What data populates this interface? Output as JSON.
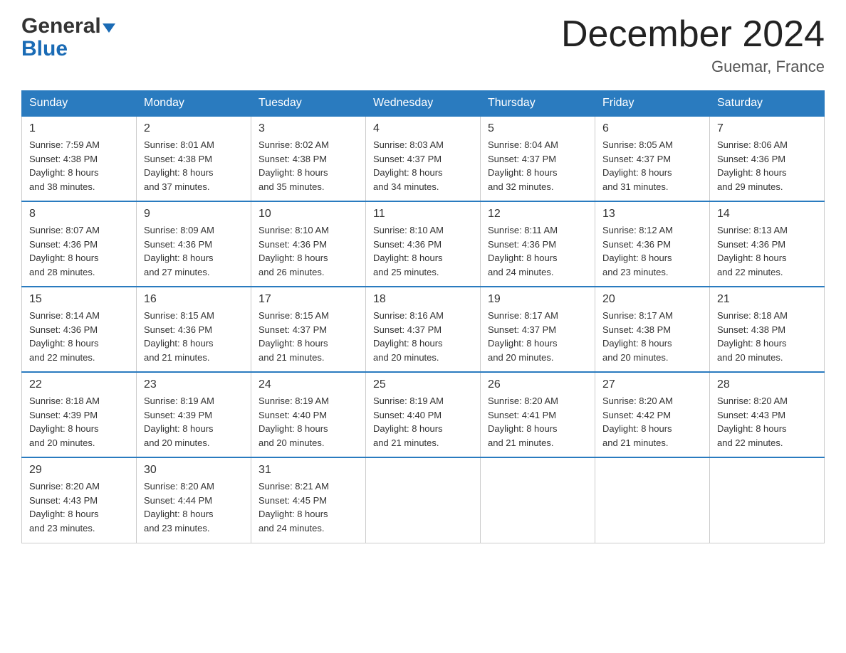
{
  "logo": {
    "general": "General",
    "blue": "Blue",
    "triangle": "▼"
  },
  "title": "December 2024",
  "location": "Guemar, France",
  "days_of_week": [
    "Sunday",
    "Monday",
    "Tuesday",
    "Wednesday",
    "Thursday",
    "Friday",
    "Saturday"
  ],
  "weeks": [
    [
      {
        "day": "1",
        "sunrise": "7:59 AM",
        "sunset": "4:38 PM",
        "daylight": "8 hours and 38 minutes."
      },
      {
        "day": "2",
        "sunrise": "8:01 AM",
        "sunset": "4:38 PM",
        "daylight": "8 hours and 37 minutes."
      },
      {
        "day": "3",
        "sunrise": "8:02 AM",
        "sunset": "4:38 PM",
        "daylight": "8 hours and 35 minutes."
      },
      {
        "day": "4",
        "sunrise": "8:03 AM",
        "sunset": "4:37 PM",
        "daylight": "8 hours and 34 minutes."
      },
      {
        "day": "5",
        "sunrise": "8:04 AM",
        "sunset": "4:37 PM",
        "daylight": "8 hours and 32 minutes."
      },
      {
        "day": "6",
        "sunrise": "8:05 AM",
        "sunset": "4:37 PM",
        "daylight": "8 hours and 31 minutes."
      },
      {
        "day": "7",
        "sunrise": "8:06 AM",
        "sunset": "4:36 PM",
        "daylight": "8 hours and 29 minutes."
      }
    ],
    [
      {
        "day": "8",
        "sunrise": "8:07 AM",
        "sunset": "4:36 PM",
        "daylight": "8 hours and 28 minutes."
      },
      {
        "day": "9",
        "sunrise": "8:09 AM",
        "sunset": "4:36 PM",
        "daylight": "8 hours and 27 minutes."
      },
      {
        "day": "10",
        "sunrise": "8:10 AM",
        "sunset": "4:36 PM",
        "daylight": "8 hours and 26 minutes."
      },
      {
        "day": "11",
        "sunrise": "8:10 AM",
        "sunset": "4:36 PM",
        "daylight": "8 hours and 25 minutes."
      },
      {
        "day": "12",
        "sunrise": "8:11 AM",
        "sunset": "4:36 PM",
        "daylight": "8 hours and 24 minutes."
      },
      {
        "day": "13",
        "sunrise": "8:12 AM",
        "sunset": "4:36 PM",
        "daylight": "8 hours and 23 minutes."
      },
      {
        "day": "14",
        "sunrise": "8:13 AM",
        "sunset": "4:36 PM",
        "daylight": "8 hours and 22 minutes."
      }
    ],
    [
      {
        "day": "15",
        "sunrise": "8:14 AM",
        "sunset": "4:36 PM",
        "daylight": "8 hours and 22 minutes."
      },
      {
        "day": "16",
        "sunrise": "8:15 AM",
        "sunset": "4:36 PM",
        "daylight": "8 hours and 21 minutes."
      },
      {
        "day": "17",
        "sunrise": "8:15 AM",
        "sunset": "4:37 PM",
        "daylight": "8 hours and 21 minutes."
      },
      {
        "day": "18",
        "sunrise": "8:16 AM",
        "sunset": "4:37 PM",
        "daylight": "8 hours and 20 minutes."
      },
      {
        "day": "19",
        "sunrise": "8:17 AM",
        "sunset": "4:37 PM",
        "daylight": "8 hours and 20 minutes."
      },
      {
        "day": "20",
        "sunrise": "8:17 AM",
        "sunset": "4:38 PM",
        "daylight": "8 hours and 20 minutes."
      },
      {
        "day": "21",
        "sunrise": "8:18 AM",
        "sunset": "4:38 PM",
        "daylight": "8 hours and 20 minutes."
      }
    ],
    [
      {
        "day": "22",
        "sunrise": "8:18 AM",
        "sunset": "4:39 PM",
        "daylight": "8 hours and 20 minutes."
      },
      {
        "day": "23",
        "sunrise": "8:19 AM",
        "sunset": "4:39 PM",
        "daylight": "8 hours and 20 minutes."
      },
      {
        "day": "24",
        "sunrise": "8:19 AM",
        "sunset": "4:40 PM",
        "daylight": "8 hours and 20 minutes."
      },
      {
        "day": "25",
        "sunrise": "8:19 AM",
        "sunset": "4:40 PM",
        "daylight": "8 hours and 21 minutes."
      },
      {
        "day": "26",
        "sunrise": "8:20 AM",
        "sunset": "4:41 PM",
        "daylight": "8 hours and 21 minutes."
      },
      {
        "day": "27",
        "sunrise": "8:20 AM",
        "sunset": "4:42 PM",
        "daylight": "8 hours and 21 minutes."
      },
      {
        "day": "28",
        "sunrise": "8:20 AM",
        "sunset": "4:43 PM",
        "daylight": "8 hours and 22 minutes."
      }
    ],
    [
      {
        "day": "29",
        "sunrise": "8:20 AM",
        "sunset": "4:43 PM",
        "daylight": "8 hours and 23 minutes."
      },
      {
        "day": "30",
        "sunrise": "8:20 AM",
        "sunset": "4:44 PM",
        "daylight": "8 hours and 23 minutes."
      },
      {
        "day": "31",
        "sunrise": "8:21 AM",
        "sunset": "4:45 PM",
        "daylight": "8 hours and 24 minutes."
      },
      null,
      null,
      null,
      null
    ]
  ],
  "labels": {
    "sunrise": "Sunrise: ",
    "sunset": "Sunset: ",
    "daylight": "Daylight: "
  }
}
